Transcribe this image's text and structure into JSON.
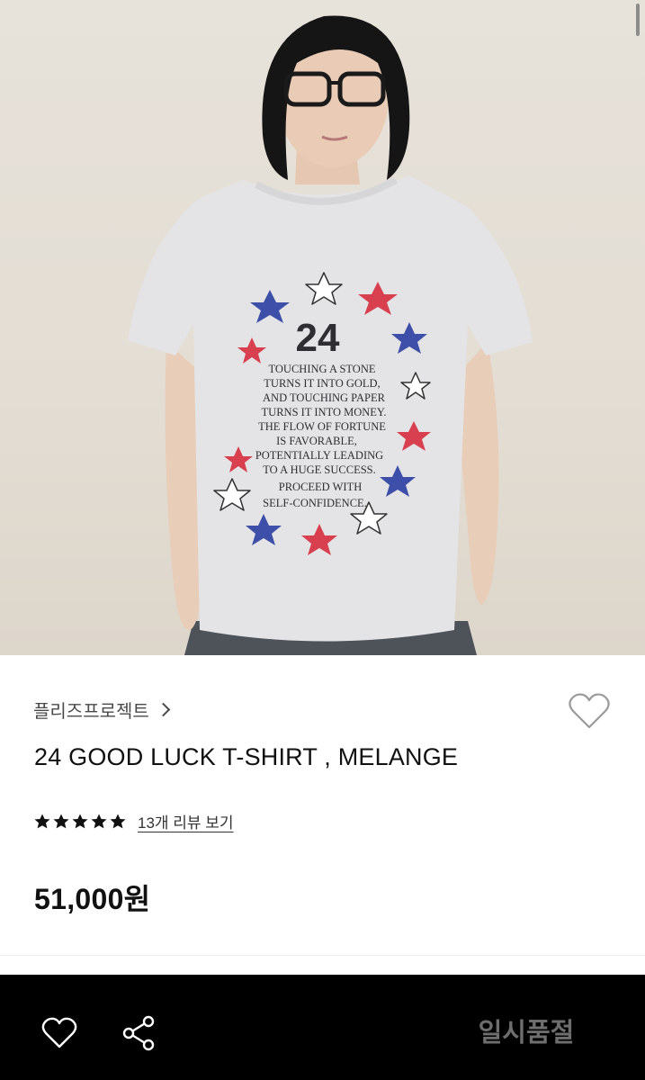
{
  "product_image": {
    "alt": "product photo",
    "shirt_print": {
      "number": "24",
      "lines": [
        "TOUCHING A STONE",
        "TURNS IT INTO GOLD,",
        "AND TOUCHING PAPER",
        "TURNS IT INTO MONEY.",
        "THE FLOW OF FORTUNE",
        "IS FAVORABLE,",
        "POTENTIALLY LEADING",
        "TO A HUGE SUCCESS.",
        "PROCEED WITH",
        "SELF-CONFIDENCE."
      ]
    }
  },
  "product": {
    "brand": "플리즈프로젝트",
    "title": "24 GOOD LUCK T-SHIRT , MELANGE",
    "rating": 5,
    "rating_max": 5,
    "review_link": "13개 리뷰 보기",
    "price": "51,000원"
  },
  "bottom_bar": {
    "status_button": "일시품절"
  },
  "colors": {
    "star_fill": "#111111",
    "bottom_bar_bg": "#000000",
    "soldout_text": "#6e6e6e",
    "print_red": "#d8404f",
    "print_blue": "#3d4fa8"
  },
  "icons": {
    "wish": "heart-outline-icon",
    "share": "share-icon",
    "brand_more": "chevron-right-icon",
    "rating": "star-icon"
  }
}
